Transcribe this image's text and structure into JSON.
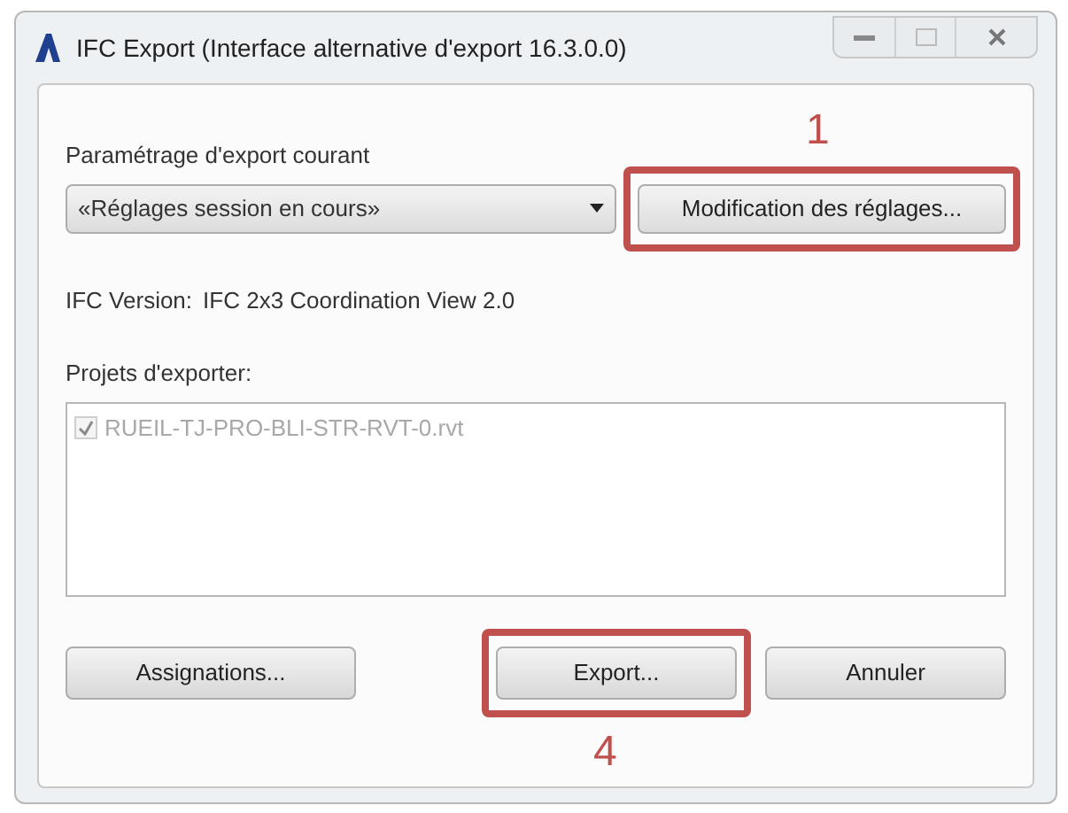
{
  "window": {
    "title": "IFC Export (Interface alternative d'export 16.3.0.0)"
  },
  "setup": {
    "label": "Paramétrage d'export courant",
    "value": "«Réglages session en cours»",
    "modify_button": "Modification des réglages...",
    "annotation": "1"
  },
  "ifc_version": {
    "label": "IFC Version:",
    "value": "IFC 2x3 Coordination View 2.0"
  },
  "projects": {
    "label": "Projets d'exporter:",
    "items": [
      {
        "name": "RUEIL-TJ-PRO-BLI-STR-RVT-0.rvt",
        "checked": true,
        "disabled": true
      }
    ]
  },
  "buttons": [
    {
      "label": "Assignations...",
      "kind": "left"
    },
    {
      "label": "Export...",
      "kind": "right",
      "annotation": "4"
    },
    {
      "label": "Annuler",
      "kind": "right"
    }
  ]
}
